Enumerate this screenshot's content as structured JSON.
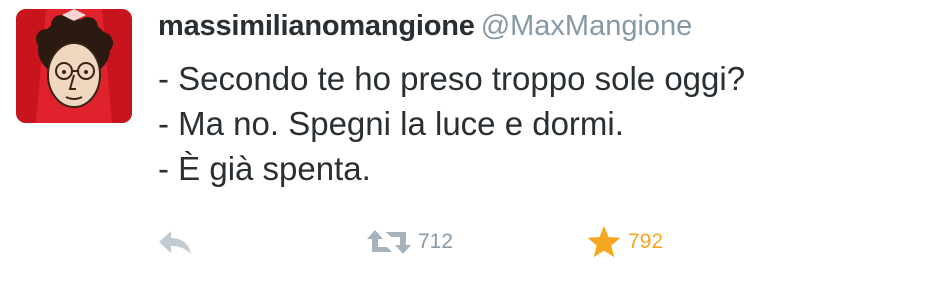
{
  "tweet": {
    "display_name": "massimilianomangione",
    "handle": "@MaxMangione",
    "text_lines": [
      "- Secondo te ho preso troppo sole oggi?",
      "- Ma no. Spegni la luce e dormi.",
      "- È già spenta."
    ],
    "actions": {
      "reply_icon": "reply-arrow-icon",
      "retweet_icon": "retweet-icon",
      "retweet_count": "712",
      "favorite_icon": "star-icon",
      "favorite_count": "792"
    }
  },
  "colors": {
    "text": "#292f33",
    "muted": "#8899a6",
    "favorite": "#f5a623",
    "avatar_bg": "#e0222c"
  }
}
